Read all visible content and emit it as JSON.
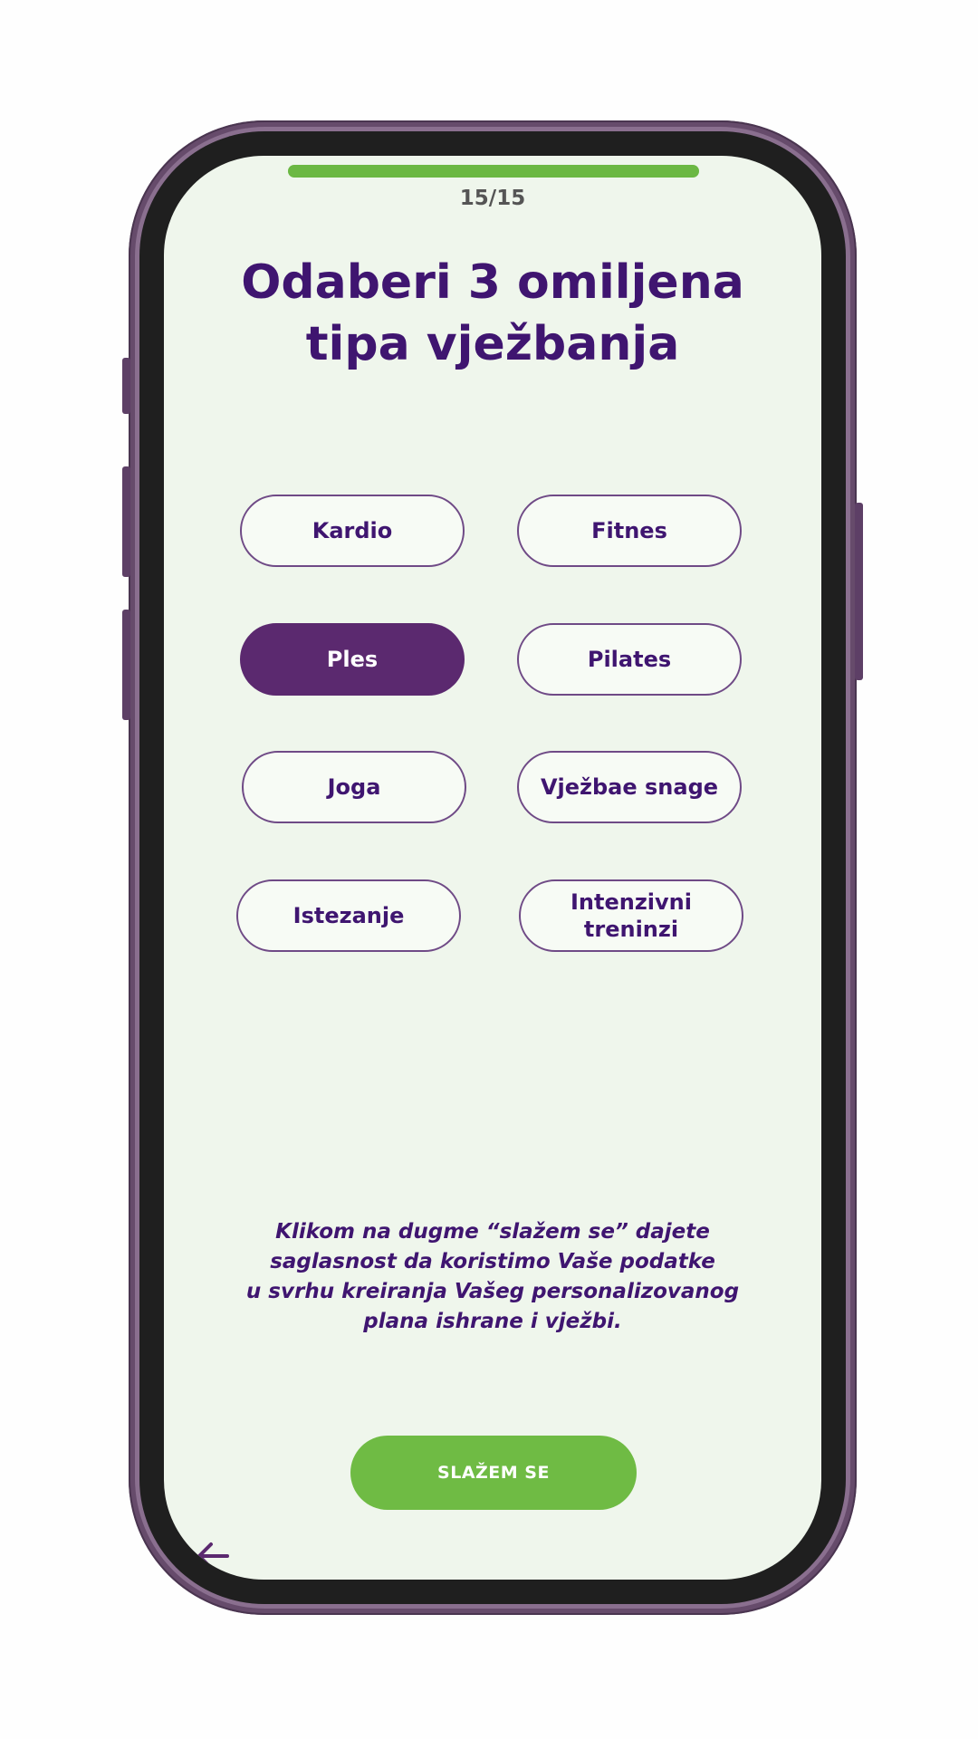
{
  "progress": {
    "current": 15,
    "total": 15,
    "fraction": 1.0,
    "label": "15/15",
    "color": "#6bb843"
  },
  "title": {
    "line1": "Odaberi 3 omiljena",
    "line2": "tipa vježbanja"
  },
  "options": [
    {
      "label": "Kardio",
      "selected": false
    },
    {
      "label": "Fitnes",
      "selected": false
    },
    {
      "label": "Ples",
      "selected": true
    },
    {
      "label": "Pilates",
      "selected": false
    },
    {
      "label": "Joga",
      "selected": false
    },
    {
      "label": "Vježbae snage",
      "selected": false
    },
    {
      "label": "Istezanje",
      "selected": false
    },
    {
      "label": "Intenzivni\ntreninzi",
      "selected": false
    }
  ],
  "consent_text": "Klikom na dugme “slažem se” dajete\nsaglasnost da koristimo Vaše podatke\nu  svrhu kreiranja Vašeg personalizovanog\nplana ishrane i vježbi.",
  "agree_button": {
    "label": "SLAŽEM SE",
    "color": "#6fbb44"
  },
  "back_icon": "arrow-left-icon",
  "colors": {
    "primary": "#3f1570",
    "selected": "#5b296f",
    "screen_background": "#eff6ec",
    "frame": "#664b6b"
  }
}
